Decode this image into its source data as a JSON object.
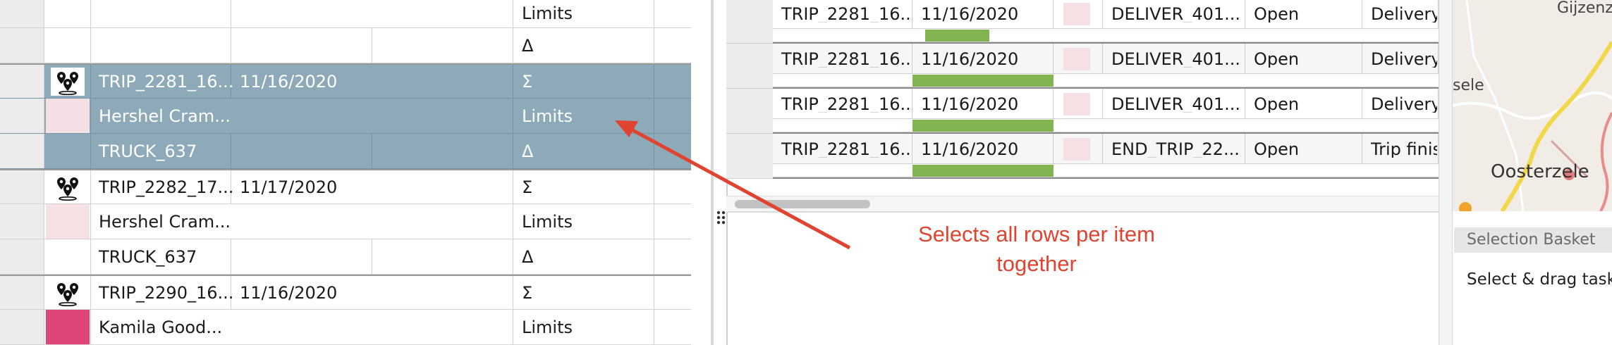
{
  "left_grid": {
    "rows": [
      {
        "c1": "",
        "c2": "",
        "c3": "",
        "c4": "Limits",
        "kind": "plain"
      },
      {
        "c1": "",
        "c2": "",
        "c3": "",
        "c4": "Δ",
        "kind": "plain"
      },
      {
        "c1": "TRIP_2281_16...",
        "c2": "11/16/2020",
        "c3": "",
        "c4": "Σ",
        "kind": "trip",
        "selected": true
      },
      {
        "c1": "Hershel Cram...",
        "c2": "",
        "c3": "",
        "c4": "Limits",
        "kind": "driver",
        "selected": true
      },
      {
        "c1": "TRUCK_637",
        "c2": "",
        "c3": "",
        "c4": "Δ",
        "kind": "truck",
        "selected": true
      },
      {
        "c1": "TRIP_2282_17...",
        "c2": "11/17/2020",
        "c3": "",
        "c4": "Σ",
        "kind": "trip"
      },
      {
        "c1": "Hershel Cram...",
        "c2": "",
        "c3": "",
        "c4": "Limits",
        "kind": "driver"
      },
      {
        "c1": "TRUCK_637",
        "c2": "",
        "c3": "",
        "c4": "Δ",
        "kind": "truck"
      },
      {
        "c1": "TRIP_2290_16...",
        "c2": "11/16/2020",
        "c3": "",
        "c4": "Σ",
        "kind": "trip"
      },
      {
        "c1": "Kamila Good...",
        "c2": "",
        "c3": "",
        "c4": "Limits",
        "kind": "driver2"
      }
    ],
    "colors": {
      "selected_row": "#8eaab9",
      "driver_swatch": "#f5e0e4",
      "driver2_swatch": "#e0457a"
    }
  },
  "annotation": {
    "text_line1": "Selects all rows per item",
    "text_line2": "together",
    "color": "#e0432f"
  },
  "tasks_table": {
    "rows": [
      {
        "trip": "TRIP_2281_16...",
        "date": "11/16/2020",
        "task": "DELIVER_401...",
        "status": "Open",
        "type": "Delivery",
        "progress": 0.48
      },
      {
        "trip": "TRIP_2281_16...",
        "date": "11/16/2020",
        "task": "DELIVER_401...",
        "status": "Open",
        "type": "Delivery",
        "progress": 1.0
      },
      {
        "trip": "TRIP_2281_16...",
        "date": "11/16/2020",
        "task": "DELIVER_401...",
        "status": "Open",
        "type": "Delivery",
        "progress": 1.0
      },
      {
        "trip": "TRIP_2281_16...",
        "date": "11/16/2020",
        "task": "END_TRIP_22...",
        "status": "Open",
        "type": "Trip finish",
        "progress": 1.0
      }
    ],
    "bar_color": "#84b451"
  },
  "map": {
    "labels": {
      "top": "Gijzenz",
      "left": "sele",
      "city": "Oosterzele"
    }
  },
  "selection_basket": {
    "title": "Selection Basket",
    "hint": "Select & drag tasks"
  }
}
